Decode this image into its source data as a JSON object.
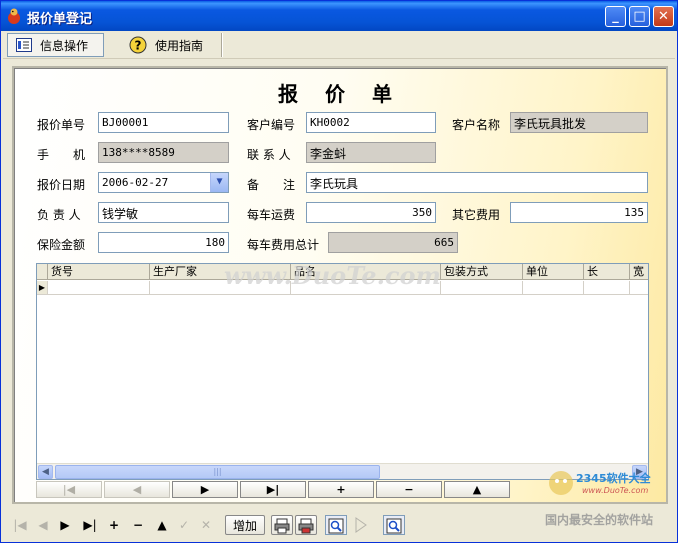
{
  "window": {
    "title": "报价单登记",
    "minimize": "_",
    "maximize": "□",
    "close": "✕"
  },
  "toolbar": {
    "tab_info": "信息操作",
    "tab_guide": "使用指南"
  },
  "form": {
    "heading": "报 价 单",
    "quote_no": {
      "label": "报价单号",
      "value": "BJ00001"
    },
    "customer_no": {
      "label": "客户编号",
      "value": "KH0002"
    },
    "customer_name": {
      "label": "客户名称",
      "value": "李氏玩具批发"
    },
    "mobile": {
      "label": "手　　机",
      "value": "138****8589"
    },
    "contact": {
      "label": "联 系 人",
      "value": "李金蚪"
    },
    "quote_date": {
      "label": "报价日期",
      "value": "2006-02-27"
    },
    "remark": {
      "label": "备　　注",
      "value": "李氏玩具"
    },
    "owner": {
      "label": "负 责 人",
      "value": "钱学敏"
    },
    "freight": {
      "label": "每车运费",
      "value": "350"
    },
    "other_fee": {
      "label": "其它费用",
      "value": "135"
    },
    "insurance": {
      "label": "保险金额",
      "value": "180"
    },
    "total_fee": {
      "label": "每车费用总计",
      "value": "665"
    }
  },
  "grid": {
    "columns": [
      "货号",
      "生产厂家",
      "品名",
      "包装方式",
      "单位",
      "长",
      "宽"
    ],
    "row_marker": "▶",
    "scroll_left": "◀",
    "scroll_right": "▶",
    "thumb_grip": "|||"
  },
  "grid_nav": {
    "first": "|◀",
    "prev": "◀",
    "next": "▶",
    "last": "▶|",
    "add": "+",
    "remove": "−",
    "up": "▲"
  },
  "bottom": {
    "first": "|◀",
    "prev": "◀",
    "next": "▶",
    "last": "▶|",
    "insert": "+",
    "delete": "−",
    "up": "▲",
    "check": "✓",
    "cancel": "✕",
    "add_label": "增加",
    "watermark_site": "国内最安全的软件站",
    "watermark_url": "www.DuoTe.com",
    "logo_text": "2345软件大全"
  },
  "watermark": "www.DuoTe.com",
  "colors": {
    "titlebar": "#0a58e1",
    "form_gradient_end": "#fde9a2",
    "readonly_bg": "#d4d0c8"
  }
}
